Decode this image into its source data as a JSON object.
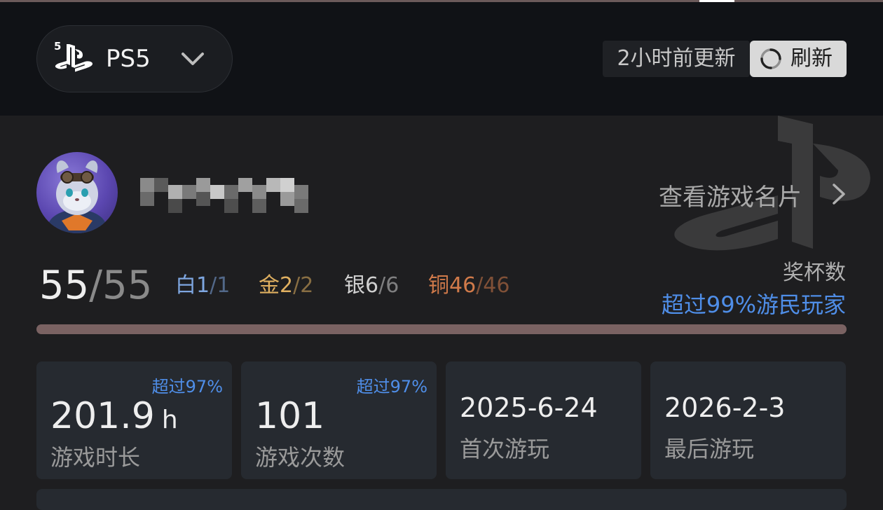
{
  "header": {
    "platform": "PS5",
    "updated_text": "2小时前更新",
    "refresh_label": "刷新"
  },
  "profile": {
    "view_card_label": "查看游戏名片"
  },
  "trophies": {
    "earned": "55",
    "separator": "/",
    "total": "55",
    "platinum": {
      "name": "白",
      "earned": "1",
      "rest": "/1"
    },
    "gold": {
      "name": "金",
      "earned": "2",
      "rest": "/2"
    },
    "silver": {
      "name": "银",
      "earned": "6",
      "rest": "/6"
    },
    "bronze": {
      "name": "铜",
      "earned": "46",
      "rest": "/46"
    },
    "label": "奖杯数",
    "rank": "超过99%游民玩家",
    "completion": 1.0
  },
  "stats": [
    {
      "badge": "超过97%",
      "value": "201.9",
      "unit": "h",
      "caption": "游戏时长"
    },
    {
      "badge": "超过97%",
      "value": "101",
      "unit": "",
      "caption": "游戏次数"
    },
    {
      "badge": "",
      "value": "2025-6-24",
      "unit": "",
      "caption": "首次游玩"
    },
    {
      "badge": "",
      "value": "2026-2-3",
      "unit": "",
      "caption": "最后游玩"
    }
  ],
  "colors": {
    "accent_blue": "#4f8ee8",
    "platinum": "#7ea6e0",
    "gold": "#e0b060",
    "silver": "#cfcfcf",
    "bronze": "#d07a4a"
  }
}
